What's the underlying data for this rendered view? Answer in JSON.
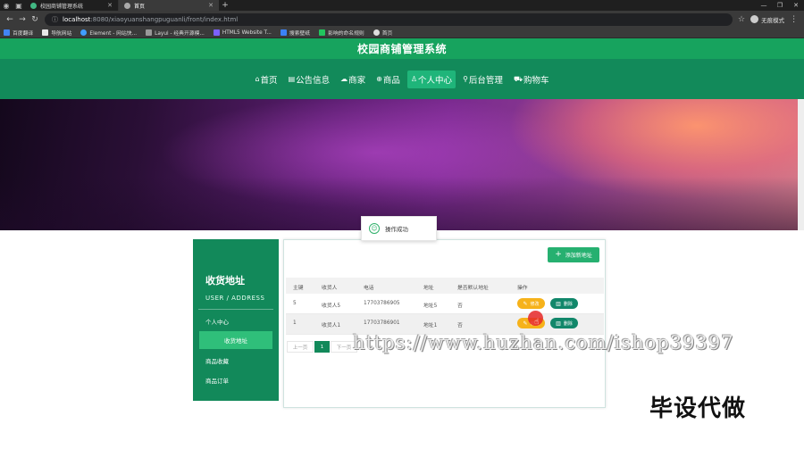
{
  "browser": {
    "tabs": [
      {
        "label": "校园商铺管理系统",
        "active": false
      },
      {
        "label": "首页",
        "active": true
      }
    ],
    "url_host": "localhost",
    "url_path": ":8080/xiaoyuanshangpuguanli/front/index.html",
    "profile_label": "无痕模式",
    "bookmarks": [
      "百度翻译",
      "导航网站",
      "Element - 网站快...",
      "Layui - 经典开源模...",
      "HTML5 Website T...",
      "搜索壁纸",
      "影响的命名规则",
      "首页"
    ]
  },
  "site": {
    "title": "校园商铺管理系统",
    "nav": [
      {
        "label": "首页",
        "icon": "home-icon",
        "glyph": "⌂",
        "active": false
      },
      {
        "label": "公告信息",
        "icon": "news-icon",
        "glyph": "▤",
        "active": false
      },
      {
        "label": "商家",
        "icon": "shop-icon",
        "glyph": "☁",
        "active": false
      },
      {
        "label": "商品",
        "icon": "globe-icon",
        "glyph": "⊕",
        "active": false
      },
      {
        "label": "个人中心",
        "icon": "user-icon",
        "glyph": "♙",
        "active": true
      },
      {
        "label": "后台管理",
        "icon": "link-icon",
        "glyph": "⚲",
        "active": false
      },
      {
        "label": "购物车",
        "icon": "cart-icon",
        "glyph": "⛟",
        "active": false
      }
    ]
  },
  "sidebar": {
    "title": "收货地址",
    "subtitle": "USER / ADDRESS",
    "items": [
      {
        "label": "个人中心",
        "active": false
      },
      {
        "label": "收货地址",
        "active": true
      },
      {
        "label": "商品收藏",
        "active": false
      },
      {
        "label": "商品订单",
        "active": false
      }
    ]
  },
  "toolbar": {
    "add_label": "添加新地址"
  },
  "table": {
    "columns": [
      "主键",
      "收货人",
      "电话",
      "地址",
      "是否默认地址",
      "操作"
    ],
    "rows": [
      {
        "id": "5",
        "name": "收货人5",
        "phone": "17703786905",
        "address": "地址5",
        "is_default": "否"
      },
      {
        "id": "1",
        "name": "收货人1",
        "phone": "17703786901",
        "address": "地址1",
        "is_default": "否"
      }
    ],
    "edit_label": "修改",
    "delete_label": "删除"
  },
  "pager": {
    "prev_label": "上一页",
    "current": "1",
    "next_label": "下一页"
  },
  "toast": {
    "message": "操作成功"
  },
  "watermark": {
    "url_text": "https://www.huzhan.com/ishop39397",
    "cn_text": "毕设代做"
  }
}
